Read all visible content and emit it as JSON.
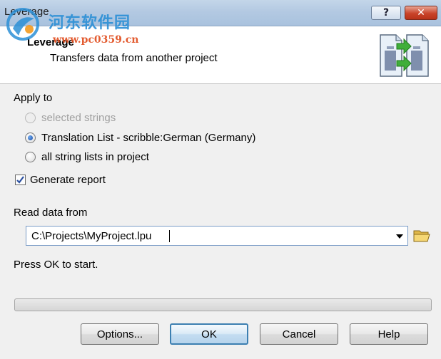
{
  "window": {
    "title": "Leverage",
    "help_glyph": "?",
    "close_glyph": "✕"
  },
  "watermark": {
    "title": "河东软件园",
    "url": "www.pc0359.cn"
  },
  "header": {
    "title": "Leverage",
    "subtitle": "Transfers data from another project",
    "icon": "leverage-transfer-icon"
  },
  "apply_to": {
    "label": "Apply to",
    "options": [
      {
        "label": "selected strings",
        "checked": false,
        "enabled": false
      },
      {
        "label": "Translation List - scribble:German (Germany)",
        "checked": true,
        "enabled": true
      },
      {
        "label": "all string lists in project",
        "checked": false,
        "enabled": true
      }
    ]
  },
  "generate_report": {
    "label": "Generate report",
    "checked": true
  },
  "read_data": {
    "label": "Read data from",
    "value": "C:\\Projects\\MyProject.lpu",
    "browse_icon": "folder-icon"
  },
  "status": {
    "text": "Press OK to start.",
    "progress": 0
  },
  "buttons": {
    "options": "Options...",
    "ok": "OK",
    "cancel": "Cancel",
    "help": "Help"
  },
  "colors": {
    "accent": "#3c7fb1",
    "close_button": "#c9432a"
  }
}
